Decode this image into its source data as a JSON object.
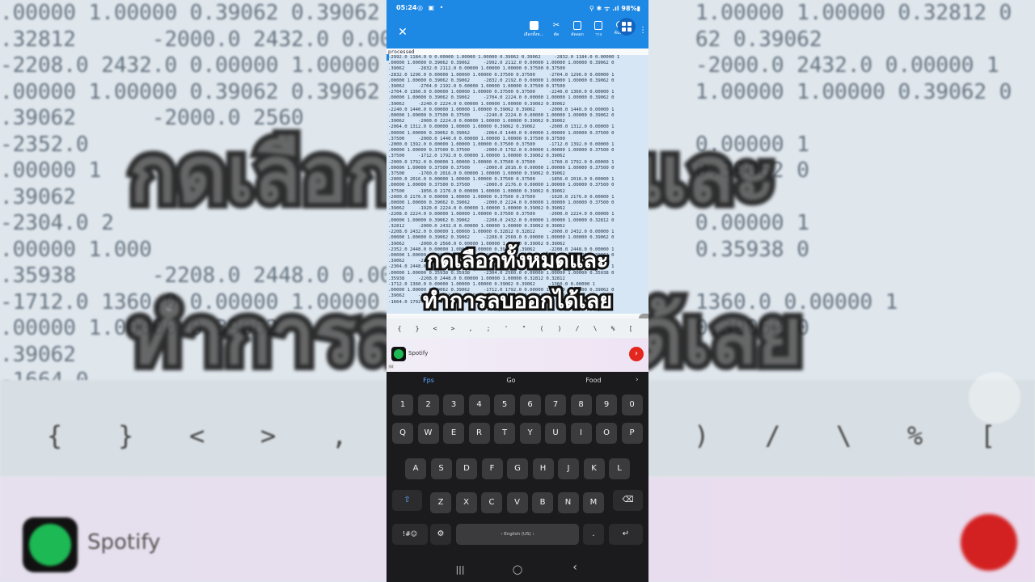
{
  "background": {
    "text_lines": [
      ".00000 1.00000 0.39062 0.39062",
      ".32812      -2000.0 2432.0 0.0000",
      "-2208.0 2432.0 0.00000 1.00000",
      ".00000 1.00000 0.39062 0.39062",
      ".39062      -2000.0 2560",
      "-2352.0",
      ".00000 1",
      ".39062",
      "-2304.0 2",
      ".00000 1.000",
      ".35938      -2208.0 2448.0 0.00000",
      "-1712.0 1360.0 0.00000 1.00000",
      ".00000 1.00000 0.39062",
      ".39062",
      "-1664.0"
    ],
    "right_text_lines": [
      "1.00000 1.00000 0.32812 0",
      "62 0.39062",
      "-2000.0 2432.0 0.00000 1",
      "1.00000 1.00000 0.39062 0",
      "",
      "0.00000 1",
      "0.39062 0",
      "",
      "0.00000 1",
      "0.35938 0",
      "",
      "1360.0 0.00000 1",
      "0.39062 0"
    ],
    "caption_line1": "กดเลือกทั้งหมดและ",
    "caption_line2": "ทำการลบออกได้เลย",
    "symbols": [
      "{",
      "}",
      "<",
      ">",
      ",",
      ")",
      "/",
      "\\",
      "%",
      "["
    ],
    "ad_name": "Spotify"
  },
  "status_bar": {
    "time": "05:24",
    "left_icons": "◎ ▣ •",
    "right": "⚲ ✱ ᯤ .ıl 98%▮"
  },
  "toolbar": {
    "close_icon": "✕",
    "items": [
      {
        "label": "เลือกทั้งห...",
        "icon": "select-all-icon"
      },
      {
        "label": "ตัด",
        "icon": "scissors-icon"
      },
      {
        "label": "คัดลอก",
        "icon": "copy-icon"
      },
      {
        "label": "วาง",
        "icon": "paste-icon"
      },
      {
        "label": "ค้นหา",
        "icon": "search-icon"
      }
    ],
    "more_icon": "⋮"
  },
  "document": {
    "header": "processed",
    "lines": [
      "-2992.0 1184.0 0 0.00000 1.00000 1.00000 0.39062 0.39062     -2832.0 1184.0 0.00000 1",
      ".00000 1.00000 0.39062 0.39062     -2992.0 2112.0 0.00000 1.00000 1.00000 0.39062 0",
      ".39062     -2832.0 2112.0 0.00000 1.00000 1.00000 0.37500 0.37500",
      "-2832.0 1296.0 0.00000 1.00000 1.00000 0.37500 0.37500     -2704.0 1296.0 0.00000 1",
      ".00000 1.00000 0.39062 0.39062     -2832.0 2192.0 0.00000 1.00000 1.00000 0.39062 0",
      ".39062     -2704.0 2192.0 0.00000 1.00000 1.00000 0.37500 0.37500",
      "-2704.0 1360.0 0.00000 1.00000 1.00000 0.37500 0.37500     -2240.0 1360.0 0.00000 1",
      ".00000 1.00000 0.39062 0.39062     -2704.0 2224.0 0.00000 1.00000 1.00000 0.39062 0",
      ".39062     -2240.0 2224.0 0.00000 1.00000 1.00000 0.39062 0.39062",
      "-2240.0 1440.0 0.00000 1.00000 1.00000 0.39062 0.39062     -2000.0 1440.0 0.00000 1",
      ".00000 1.00000 0.37500 0.37500     -2240.0 2224.0 0.00000 1.00000 1.00000 0.39062 0",
      ".39062     -2000.0 2224.0 0.00000 1.00000 1.00000 0.39062 0.39062",
      "-2064.0 1312.0 0.00000 1.00000 1.00000 0.39062 0.39062     -2000.0 1312.0 0.00000 1",
      ".00000 1.00000 0.39062 0.39062     -2064.0 1440.0 0.00000 1.00000 1.00000 0.37500 0",
      ".37500     -2000.0 1440.0 0.00000 1.00000 1.00000 0.37500 0.37500",
      "-2000.0 1392.0 0.00000 1.00000 1.00000 0.37500 0.37500     -1712.0 1392.0 0.00000 1",
      ".00000 1.00000 0.37500 0.37500     -2000.0 1792.0 0.00000 1.00000 1.00000 0.37500 0",
      ".37500     -1712.0 1792.0 0.00000 1.00000 1.00000 0.39062 0.39062",
      "-2000.0 1792.0 0.00000 1.00000 1.00000 0.37500 0.37500     -1760.0 1792.0 0.00000 1",
      ".00000 1.00000 0.37500 0.37500     -2000.0 2016.0 0.00000 1.00000 1.00000 0.37500 0",
      ".37500     -1760.0 2016.0 0.00000 1.00000 1.00000 0.39062 0.39062",
      "-2000.0 2016.0 0.00000 1.00000 1.00000 0.37500 0.37500     -1856.0 2016.0 0.00000 1",
      ".00000 1.00000 0.37500 0.37500     -2000.0 2176.0 0.00000 1.00000 1.00000 0.37500 0",
      ".37500     -1856.0 2176.0 0.00000 1.00000 1.00000 0.39062 0.39062",
      "-2000.0 2176.0 0.00000 1.00000 1.00000 0.37500 0.37500     -1920.0 2176.0 0.00000 1",
      ".00000 1.00000 0.39062 0.39062     -2000.0 2224.0 0.00000 1.00000 1.00000 0.37500 0",
      ".39062     -1920.0 2224.0 0.00000 1.00000 1.00000 0.39062 0.39062",
      "-2208.0 2224.0 0.00000 1.00000 1.00000 0.37500 0.37500     -2000.0 2224.0 0.00000 1",
      ".00000 1.00000 0.39062 0.39062     -2208.0 2432.0 0.00000 1.00000 1.00000 0.32812 0",
      ".32812     -2000.0 2432.0 0.00000 1.00000 1.00000 0.39062 0.39062",
      "-2208.0 2432.0 0.00000 1.00000 1.00000 0.32812 0.32812     -2000.0 2432.0 0.00000 1",
      ".00000 1.00000 0.39062 0.39062     -2208.0 2560.0 0.00000 1.00000 1.00000 0.39062 0",
      ".39062     -2000.0 2560.0 0.00000 1.00000 1.00000 0.39062 0.39062",
      "-2352.0 2448.0 0.00000 1.00000 1.00000 0.39062 0.39062     -2208.0 2448.0 0.00000 1",
      ".00000 1.00000 0.39062 0.39062     -2352.0 2560.0 0.00000 1.00000 1.00000 0.39062 0",
      ".39062     -2208.0 2560.0 0.00000 1.00000 1.00000 0.39062 0.39062",
      "-2304.0 2448.0 0.00000 1.00000 1.00000 0.39062 0.39062     -2208.0 2448.0 0.00000 1",
      ".00000 1.00000 0.35938 0.35938     -2304.0 2560.0 0.00000 1.00000 1.00000 0.35938 0",
      ".35938     -2208.0 2448.0 0.00000 1.00000 1.00000 0.32812 0.32812",
      "-1712.0 1360.0 0.00000 1.00000 1.00000 0.39062 0.39062     -1360.0 0.00000 1",
      ".00000 1.00000 0.39062 0.39062     -1712.0 1792.0 0.00000 1.00000 1.00000 0.39062 0",
      ".39062     -1664.0 1360.0 0.00000 1.00000 1.00000 0.39062 0.39062",
      "-1664.0 1792.0 0.00000 1.00000 1.00000 0.39062 0.39062"
    ],
    "caption_line1": "กดเลือกทั้งหมดและ",
    "caption_line2": "ทำการลบออกได้เลย"
  },
  "symbol_bar": [
    "{",
    "}",
    "<",
    ">",
    ",",
    ";",
    "'",
    "\"",
    "(",
    ")",
    "/",
    "\\",
    "%",
    "["
  ],
  "ad": {
    "name": "Spotify",
    "badge": "Ad",
    "go_icon": "›"
  },
  "keyboard": {
    "suggestions": [
      "Fps",
      "Go",
      "Food"
    ],
    "suggest_arrow": "›",
    "row_numbers": [
      "1",
      "2",
      "3",
      "4",
      "5",
      "6",
      "7",
      "8",
      "9",
      "0"
    ],
    "row1": [
      "Q",
      "W",
      "E",
      "R",
      "T",
      "Y",
      "U",
      "I",
      "O",
      "P"
    ],
    "row2": [
      "A",
      "S",
      "D",
      "F",
      "G",
      "H",
      "J",
      "K",
      "L"
    ],
    "row3": [
      "Z",
      "X",
      "C",
      "V",
      "B",
      "N",
      "M"
    ],
    "shift": "⇧",
    "backspace": "⌫",
    "symbols_key": "!#☺",
    "settings_key": "⚙",
    "space_label": "‹ English (US) ›",
    "period": ".",
    "enter": "↵"
  },
  "navbar": {
    "recents": "|||",
    "home": "◯",
    "back": "‹"
  }
}
